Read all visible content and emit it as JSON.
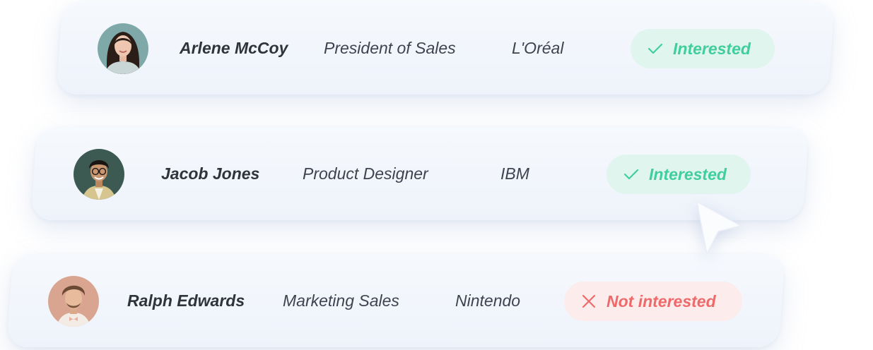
{
  "leads": [
    {
      "name": "Arlene McCoy",
      "role": "President of Sales",
      "company": "L'Oréal",
      "status": "Interested",
      "status_type": "positive",
      "status_icon": "check-icon"
    },
    {
      "name": "Jacob Jones",
      "role": "Product Designer",
      "company": "IBM",
      "status": "Interested",
      "status_type": "positive",
      "status_icon": "check-icon"
    },
    {
      "name": "Ralph Edwards",
      "role": "Marketing Sales",
      "company": "Nintendo",
      "status": "Not interested",
      "status_type": "negative",
      "status_icon": "x-icon"
    }
  ],
  "colors": {
    "positive_text": "#3fcf9c",
    "positive_bg": "#e1f5ef",
    "negative_text": "#ee6a6a",
    "negative_bg": "#fdecec"
  }
}
